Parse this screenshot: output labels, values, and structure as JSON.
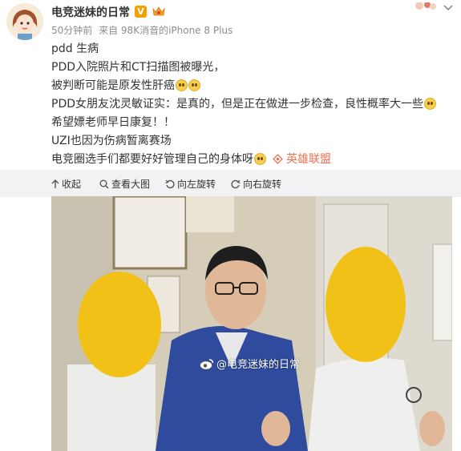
{
  "post": {
    "username": "电竞迷妹的日常",
    "verified_badge": "V",
    "meta": {
      "time": "50分钟前",
      "source": "来自 98K消音的iPhone 8 Plus"
    },
    "lines": [
      "pdd 生病",
      "PDD入院照片和CT扫描图被曝光，",
      "被判断可能是原发性肝癌",
      "PDD女朋友沈灵敏证实：是真的，但是正在做进一步检查，良性概率大一些",
      "希望嫖老师早日康复！！",
      "UZI也因为伤病暂离赛场",
      "电竞圈选手们都要好好管理自己的身体呀"
    ],
    "topic_link": "英雄联盟"
  },
  "toolbar": {
    "collapse": "收起",
    "view_large": "查看大图",
    "rotate_left": "向左旋转",
    "rotate_right": "向右旋转"
  },
  "image": {
    "watermark": "@电竞迷妹的日常"
  },
  "colors": {
    "link": "#eb7350",
    "toolbar_bg": "#f2f2f5",
    "meta_text": "#8d8d8d"
  }
}
